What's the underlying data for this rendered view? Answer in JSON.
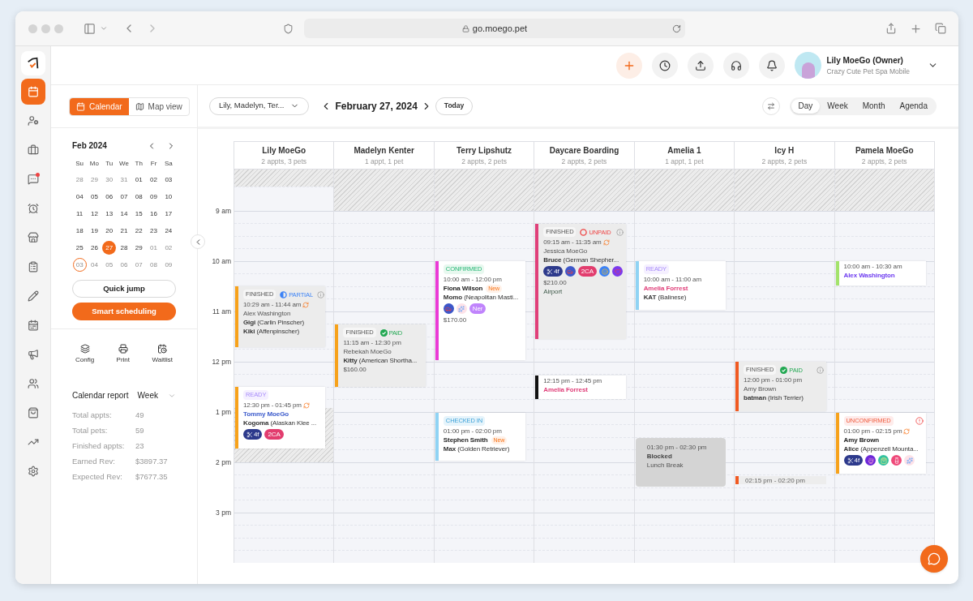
{
  "browser": {
    "url": "go.moego.pet"
  },
  "nav": [
    {
      "selected": true,
      "badge": false
    },
    {
      "selected": false,
      "badge": false
    },
    {
      "selected": false,
      "badge": false
    },
    {
      "selected": false,
      "badge": true
    },
    {
      "selected": false,
      "badge": false
    },
    {
      "selected": false,
      "badge": false
    },
    {
      "selected": false,
      "badge": false
    },
    {
      "selected": false,
      "badge": false
    },
    {
      "selected": false,
      "badge": false
    },
    {
      "selected": false,
      "badge": false
    },
    {
      "selected": false,
      "badge": false
    },
    {
      "selected": false,
      "badge": false
    },
    {
      "selected": false,
      "badge": false
    },
    {
      "selected": false,
      "badge": false
    }
  ],
  "header": {
    "user": "Lily MoeGo (Owner)",
    "business": "Crazy Cute Pet Spa Mobile"
  },
  "view_toggle": [
    {
      "label": "Calendar",
      "selected": true
    },
    {
      "label": "Map view",
      "selected": false
    }
  ],
  "mini_calendar": {
    "month": "Feb 2024",
    "weekdays": [
      "Su",
      "Mo",
      "Tu",
      "We",
      "Th",
      "Fr",
      "Sa"
    ],
    "days": [
      {
        "d": "28",
        "muted": true,
        "selected": false,
        "marked": false
      },
      {
        "d": "29",
        "muted": true,
        "selected": false,
        "marked": false
      },
      {
        "d": "30",
        "muted": true,
        "selected": false,
        "marked": false
      },
      {
        "d": "31",
        "muted": true,
        "selected": false,
        "marked": false
      },
      {
        "d": "01",
        "muted": false,
        "selected": false,
        "marked": false
      },
      {
        "d": "02",
        "muted": false,
        "selected": false,
        "marked": false
      },
      {
        "d": "03",
        "muted": false,
        "selected": false,
        "marked": false
      },
      {
        "d": "04",
        "muted": false,
        "selected": false,
        "marked": false
      },
      {
        "d": "05",
        "muted": false,
        "selected": false,
        "marked": false
      },
      {
        "d": "06",
        "muted": false,
        "selected": false,
        "marked": false
      },
      {
        "d": "07",
        "muted": false,
        "selected": false,
        "marked": false
      },
      {
        "d": "08",
        "muted": false,
        "selected": false,
        "marked": false
      },
      {
        "d": "09",
        "muted": false,
        "selected": false,
        "marked": false
      },
      {
        "d": "10",
        "muted": false,
        "selected": false,
        "marked": false
      },
      {
        "d": "11",
        "muted": false,
        "selected": false,
        "marked": false
      },
      {
        "d": "12",
        "muted": false,
        "selected": false,
        "marked": false
      },
      {
        "d": "13",
        "muted": false,
        "selected": false,
        "marked": false
      },
      {
        "d": "14",
        "muted": false,
        "selected": false,
        "marked": false
      },
      {
        "d": "15",
        "muted": false,
        "selected": false,
        "marked": false
      },
      {
        "d": "16",
        "muted": false,
        "selected": false,
        "marked": false
      },
      {
        "d": "17",
        "muted": false,
        "selected": false,
        "marked": false
      },
      {
        "d": "18",
        "muted": false,
        "selected": false,
        "marked": false
      },
      {
        "d": "19",
        "muted": false,
        "selected": false,
        "marked": false
      },
      {
        "d": "20",
        "muted": false,
        "selected": false,
        "marked": false
      },
      {
        "d": "21",
        "muted": false,
        "selected": false,
        "marked": false
      },
      {
        "d": "22",
        "muted": false,
        "selected": false,
        "marked": false
      },
      {
        "d": "23",
        "muted": false,
        "selected": false,
        "marked": false
      },
      {
        "d": "24",
        "muted": false,
        "selected": false,
        "marked": false
      },
      {
        "d": "25",
        "muted": false,
        "selected": false,
        "marked": false
      },
      {
        "d": "26",
        "muted": false,
        "selected": false,
        "marked": false
      },
      {
        "d": "27",
        "muted": false,
        "selected": true,
        "marked": false
      },
      {
        "d": "28",
        "muted": false,
        "selected": false,
        "marked": false
      },
      {
        "d": "29",
        "muted": false,
        "selected": false,
        "marked": false
      },
      {
        "d": "01",
        "muted": true,
        "selected": false,
        "marked": false
      },
      {
        "d": "02",
        "muted": true,
        "selected": false,
        "marked": false
      },
      {
        "d": "03",
        "muted": true,
        "selected": false,
        "marked": true
      },
      {
        "d": "04",
        "muted": true,
        "selected": false,
        "marked": false
      },
      {
        "d": "05",
        "muted": true,
        "selected": false,
        "marked": false
      },
      {
        "d": "06",
        "muted": true,
        "selected": false,
        "marked": false
      },
      {
        "d": "07",
        "muted": true,
        "selected": false,
        "marked": false
      },
      {
        "d": "08",
        "muted": true,
        "selected": false,
        "marked": false
      },
      {
        "d": "09",
        "muted": true,
        "selected": false,
        "marked": false
      }
    ]
  },
  "buttons": {
    "quick_jump": "Quick jump",
    "smart_scheduling": "Smart scheduling"
  },
  "tools": [
    {
      "label": "Config"
    },
    {
      "label": "Print"
    },
    {
      "label": "Waitlist"
    }
  ],
  "report": {
    "title": "Calendar report",
    "period": "Week",
    "rows": [
      {
        "label": "Total appts:",
        "value": "49"
      },
      {
        "label": "Total pets:",
        "value": "59"
      },
      {
        "label": "Finished appts:",
        "value": "23"
      },
      {
        "label": "Earned Rev:",
        "value": "$3897.37"
      },
      {
        "label": "Expected Rev:",
        "value": "$7677.35"
      }
    ]
  },
  "toolbar": {
    "staff_filter": "Lily, Madelyn, Ter...",
    "date": "February 27, 2024",
    "today": "Today",
    "views": [
      {
        "label": "Day",
        "selected": true
      },
      {
        "label": "Week",
        "selected": false
      },
      {
        "label": "Month",
        "selected": false
      },
      {
        "label": "Agenda",
        "selected": false
      }
    ]
  },
  "time_labels": [
    "9 am",
    "10 am",
    "11 am",
    "12 pm",
    "1 pm",
    "2 pm",
    "3 pm"
  ],
  "columns": [
    {
      "name": "Lily MoeGo",
      "summary": "2 appts, 3 pets",
      "early_open": true,
      "afternoon_blocked": true,
      "events": [
        {
          "kind": "appt",
          "color": "#f7a21b",
          "status": {
            "kind": "finished",
            "label": "FINISHED"
          },
          "payment": {
            "kind": "partial",
            "label": "PARTIAL"
          },
          "flag": {
            "kind": "info"
          },
          "time": "10:29 am - 11:44 am",
          "repeat": true,
          "client": {
            "text": "Alex Washington",
            "bold": false
          },
          "pets": [
            {
              "name": "Gigi",
              "breed": "(Carlin Pinscher)"
            },
            {
              "name": "Kiki",
              "breed": "(Affenpinscher)"
            }
          ]
        },
        {
          "kind": "appt",
          "color": "#f7a21b",
          "status": {
            "kind": "ready",
            "label": "READY"
          },
          "time": "12:30 pm - 01:45 pm",
          "repeat": true,
          "client": {
            "text": "Tommy MoeGo",
            "color": "#3d5ccc"
          },
          "pets": [
            {
              "name": "Kogoma",
              "breed": "(Alaskan Klee ..."
            }
          ],
          "tags": [
            {
              "kind": "scissors",
              "text": "4f",
              "color": "#2d3a8c"
            },
            {
              "kind": "label",
              "text": "2CA",
              "color": "#e23d6e"
            }
          ]
        }
      ]
    },
    {
      "name": "Madelyn Kenter",
      "summary": "1 appt, 1 pet",
      "early_open": false,
      "afternoon_blocked": false,
      "events": [
        {
          "kind": "appt",
          "color": "#f7a21b",
          "status": {
            "kind": "finished",
            "label": "FINISHED"
          },
          "payment": {
            "kind": "paid",
            "label": "PAID"
          },
          "time": "11:15 am - 12:30 pm",
          "repeat": false,
          "client": {
            "text": "Rebekah MoeGo",
            "bold": false
          },
          "pets": [
            {
              "name": "Kitty",
              "breed": "(American Shortha..."
            }
          ],
          "price": "$160.00"
        }
      ]
    },
    {
      "name": "Terry Lipshutz",
      "summary": "2 appts, 2 pets",
      "early_open": false,
      "afternoon_blocked": false,
      "events": [
        {
          "kind": "appt",
          "color": "#ea3bd6",
          "status": {
            "kind": "confirmed",
            "label": "CONFIRMED"
          },
          "time": "10:00 am - 12:00 pm",
          "repeat": false,
          "client": {
            "text": "Fiona Wilson",
            "bold": true
          },
          "client_new": "New",
          "pets": [
            {
              "name": "Momo",
              "breed": "(Neapolitan Masti..."
            }
          ],
          "tags": [
            {
              "kind": "car",
              "color": "#3d57c9"
            },
            {
              "kind": "bubbles",
              "color": "#fde2e8"
            },
            {
              "kind": "label",
              "text": "Ner",
              "color": "#c084fc"
            }
          ],
          "price": "$170.00"
        },
        {
          "kind": "appt",
          "color": "#8fd3f4",
          "status": {
            "kind": "checked_in",
            "label": "CHECKED IN"
          },
          "time": "01:00 pm - 02:00 pm",
          "repeat": false,
          "client": {
            "text": "Stephen Smith",
            "bold": true
          },
          "client_new": "New",
          "pets": [
            {
              "name": "Max",
              "breed": "(Golden Retriever)"
            }
          ]
        }
      ]
    },
    {
      "name": "Daycare Boarding",
      "summary": "2 appts, 2 pets",
      "early_open": false,
      "afternoon_blocked": false,
      "events": [
        {
          "kind": "appt",
          "color": "#e0407a",
          "status": {
            "kind": "finished",
            "label": "FINISHED"
          },
          "payment": {
            "kind": "unpaid",
            "label": "UNPAID"
          },
          "flag": {
            "kind": "info"
          },
          "time": "09:15 am - 11:35 am",
          "repeat": true,
          "client": {
            "text": "Jessica MoeGo",
            "bold": false
          },
          "pets": [
            {
              "name": "Bruce",
              "breed": "(German Shepher..."
            }
          ],
          "tags": [
            {
              "kind": "scissors",
              "text": "4f",
              "color": "#2d3a8c"
            },
            {
              "kind": "car",
              "color": "#3d57c9"
            },
            {
              "kind": "label",
              "text": "2CA",
              "color": "#e23d6e"
            },
            {
              "kind": "face",
              "color": "#3b82f6"
            },
            {
              "kind": "heart",
              "color": "#7c3aed"
            }
          ],
          "price": "$210.00",
          "note": "Airport"
        },
        {
          "kind": "brief",
          "color": "#111111",
          "time": "12:15 pm - 12:45 pm",
          "client": {
            "text": "Amelia Forrest",
            "color": "#e0407a"
          }
        }
      ]
    },
    {
      "name": "Amelia 1",
      "summary": "1 appt, 1 pet",
      "early_open": false,
      "afternoon_blocked": false,
      "events": [
        {
          "kind": "appt",
          "color": "#8fd3f4",
          "status": {
            "kind": "ready",
            "label": "READY"
          },
          "time": "10:00 am - 11:00 am",
          "repeat": false,
          "client": {
            "text": "Amelia Forrest",
            "color": "#e0407a"
          },
          "pets": [
            {
              "name": "KAT",
              "breed": "(Balinese)"
            }
          ]
        },
        {
          "kind": "blocked",
          "time": "01:30 pm - 02:30 pm",
          "title": "Blocked",
          "note": "Lunch Break"
        }
      ]
    },
    {
      "name": "Icy H",
      "summary": "2 appts, 2 pets",
      "early_open": false,
      "afternoon_blocked": false,
      "events": [
        {
          "kind": "appt",
          "color": "#f05a22",
          "status": {
            "kind": "finished",
            "label": "FINISHED"
          },
          "payment": {
            "kind": "paid",
            "label": "PAID"
          },
          "flag": {
            "kind": "info"
          },
          "time": "12:00 pm - 01:00 pm",
          "repeat": false,
          "client": {
            "text": "Amy Brown",
            "bold": false
          },
          "pets": [
            {
              "name": "batman",
              "breed": "(Irish Terrier)"
            }
          ]
        },
        {
          "kind": "thin",
          "color": "#f05a22",
          "time": "02:15 pm - 02:20 pm"
        }
      ]
    },
    {
      "name": "Pamela MoeGo",
      "summary": "2 appts, 2 pets",
      "early_open": false,
      "afternoon_blocked": false,
      "events": [
        {
          "kind": "brief",
          "color": "#a3e36b",
          "time": "10:00 am - 10:30 am",
          "client": {
            "text": "Alex Washington",
            "color": "#6d3bf0"
          }
        },
        {
          "kind": "appt",
          "color": "#f7a21b",
          "status": {
            "kind": "unconfirmed",
            "label": "UNCONFIRMED"
          },
          "flag": {
            "kind": "alert"
          },
          "time": "01:00 pm - 02:15 pm",
          "repeat": true,
          "client": {
            "text": "Amy Brown",
            "bold": true
          },
          "pets": [
            {
              "name": "Alice",
              "breed": "(Appenzell Mounta..."
            }
          ],
          "tags": [
            {
              "kind": "scissors",
              "text": "4f",
              "color": "#2d3a8c"
            },
            {
              "kind": "bowl",
              "color": "#6d28d9"
            },
            {
              "kind": "bag",
              "color": "#34c3a0"
            },
            {
              "kind": "bottle",
              "color": "#ef4a7a"
            },
            {
              "kind": "bubbles",
              "color": "#fde2e8"
            }
          ]
        }
      ]
    }
  ]
}
